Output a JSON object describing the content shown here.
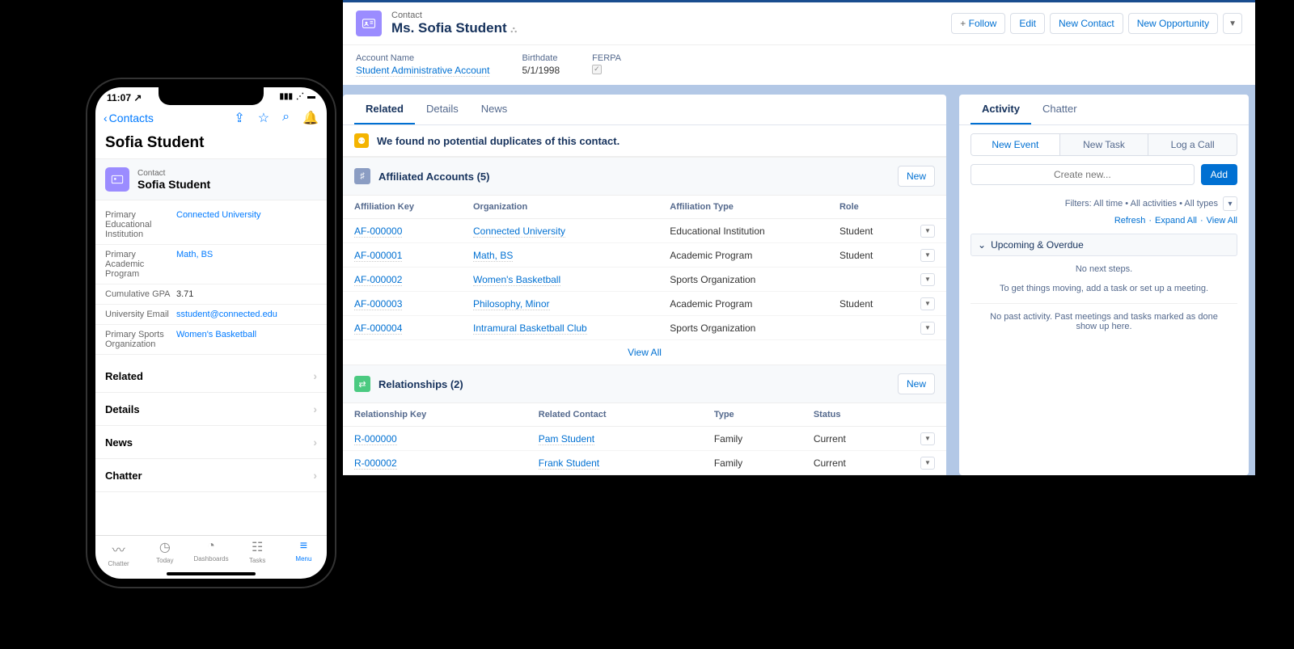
{
  "desktop": {
    "header": {
      "subtitle": "Contact",
      "title": "Ms. Sofia Student"
    },
    "actions": {
      "follow": "Follow",
      "edit": "Edit",
      "newContact": "New Contact",
      "newOpportunity": "New Opportunity"
    },
    "highlights": {
      "accountName": {
        "label": "Account Name",
        "value": "Student Administrative Account"
      },
      "birthdate": {
        "label": "Birthdate",
        "value": "5/1/1998"
      },
      "ferpa": {
        "label": "FERPA"
      }
    },
    "tabs": {
      "related": "Related",
      "details": "Details",
      "news": "News"
    },
    "banner": "We found no potential duplicates of this contact.",
    "affiliated": {
      "title": "Affiliated Accounts (5)",
      "newBtn": "New",
      "cols": [
        "Affiliation Key",
        "Organization",
        "Affiliation Type",
        "Role"
      ],
      "rows": [
        {
          "key": "AF-000000",
          "org": "Connected University",
          "type": "Educational Institution",
          "role": "Student"
        },
        {
          "key": "AF-000001",
          "org": "Math, BS",
          "type": "Academic Program",
          "role": "Student"
        },
        {
          "key": "AF-000002",
          "org": "Women's Basketball",
          "type": "Sports Organization",
          "role": ""
        },
        {
          "key": "AF-000003",
          "org": "Philosophy, Minor",
          "type": "Academic Program",
          "role": "Student"
        },
        {
          "key": "AF-000004",
          "org": "Intramural Basketball Club",
          "type": "Sports Organization",
          "role": ""
        }
      ],
      "viewAll": "View All"
    },
    "relationships": {
      "title": "Relationships (2)",
      "newBtn": "New",
      "cols": [
        "Relationship Key",
        "Related Contact",
        "Type",
        "Status"
      ],
      "rows": [
        {
          "key": "R-000000",
          "contact": "Pam Student",
          "type": "Family",
          "status": "Current"
        },
        {
          "key": "R-000002",
          "contact": "Frank Student",
          "type": "Family",
          "status": "Current"
        }
      ]
    },
    "side": {
      "tabs": {
        "activity": "Activity",
        "chatter": "Chatter"
      },
      "subtabs": {
        "newEvent": "New Event",
        "newTask": "New Task",
        "logCall": "Log a Call"
      },
      "createPlaceholder": "Create new...",
      "addBtn": "Add",
      "filters": "Filters: All time • All activities • All types",
      "refresh": "Refresh",
      "expand": "Expand All",
      "viewAll": "View All",
      "upcoming": "Upcoming & Overdue",
      "nosteps1": "No next steps.",
      "nosteps2": "To get things moving, add a task or set up a meeting.",
      "nopast": "No past activity. Past meetings and tasks marked as done show up here."
    }
  },
  "phone": {
    "time": "11:07",
    "back": "Contacts",
    "title": "Sofia Student",
    "card": {
      "sub": "Contact",
      "title": "Sofia Student"
    },
    "fields": [
      {
        "label": "Primary Educational Institution",
        "value": "Connected University",
        "link": true
      },
      {
        "label": "Primary Academic Program",
        "value": "Math, BS",
        "link": true
      },
      {
        "label": "Cumulative GPA",
        "value": "3.71",
        "link": false
      },
      {
        "label": "University Email",
        "value": "sstudent@connected.edu",
        "link": true
      },
      {
        "label": "Primary Sports Organization",
        "value": "Women's Basketball",
        "link": true
      }
    ],
    "sections": [
      "Related",
      "Details",
      "News",
      "Chatter"
    ],
    "tabbar": [
      {
        "label": "Chatter",
        "icon": "〰"
      },
      {
        "label": "Today",
        "icon": "◷"
      },
      {
        "label": "Dashboards",
        "icon": "◔"
      },
      {
        "label": "Tasks",
        "icon": "☷"
      },
      {
        "label": "Menu",
        "icon": "≡"
      }
    ]
  }
}
